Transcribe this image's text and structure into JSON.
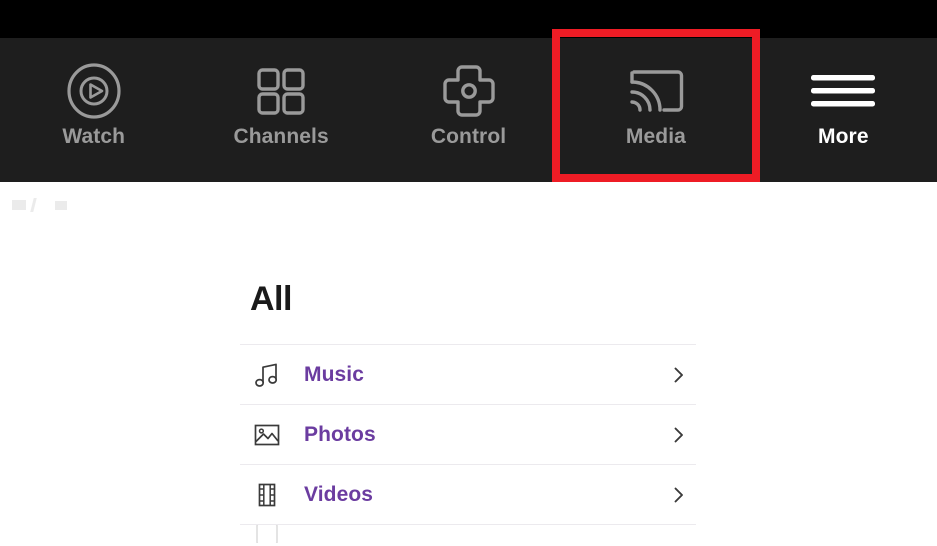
{
  "window": {
    "status_strip_color": "#000000",
    "navbar_color": "#1e1e1e",
    "content_color": "#ffffff",
    "accent_purple": "#6b3ca0",
    "highlight_color": "#ee1c25",
    "nav_label_color": "#9a9a9a",
    "nav_active_label_color": "#ffffff"
  },
  "navbar": {
    "items": [
      {
        "label": "Watch",
        "icon": "play-circle-icon",
        "active": false
      },
      {
        "label": "Channels",
        "icon": "grid-icon",
        "active": false
      },
      {
        "label": "Control",
        "icon": "dpad-icon",
        "active": false
      },
      {
        "label": "Media",
        "icon": "cast-icon",
        "active": false
      },
      {
        "label": "More",
        "icon": "hamburger-icon",
        "active": true
      }
    ],
    "highlighted_item": "Media"
  },
  "main": {
    "title": "All",
    "list": [
      {
        "label": "Music",
        "icon": "music-note-icon",
        "chevron": "chevron-right-icon"
      },
      {
        "label": "Photos",
        "icon": "photo-icon",
        "chevron": "chevron-right-icon"
      },
      {
        "label": "Videos",
        "icon": "film-strip-icon",
        "chevron": "chevron-right-icon"
      }
    ]
  }
}
